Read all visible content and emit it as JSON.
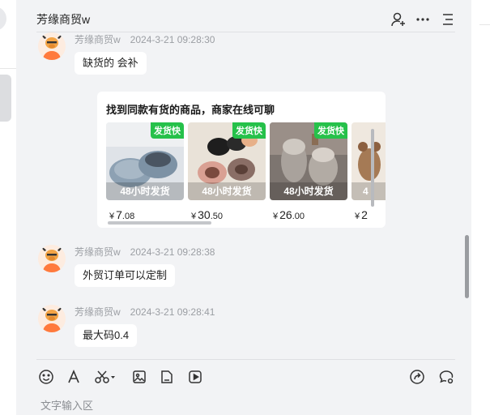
{
  "chat": {
    "title": "芳缘商贸w",
    "messages": [
      {
        "sender": "芳缘商贸w",
        "time": "2024-3-21 09:28:30",
        "text": "缺货的    会补"
      },
      {
        "sender": "芳缘商贸w",
        "time": "2024-3-21 09:28:38",
        "text": "外贸订单可以定制"
      },
      {
        "sender": "芳缘商贸w",
        "time": "2024-3-21 09:28:41",
        "text": "最大码0.4"
      }
    ],
    "product_card": {
      "title": "找到同款有货的商品，商家在线可聊",
      "products": [
        {
          "badge": "发货快",
          "caption": "48小时发货",
          "currency": "¥",
          "price_int": "7",
          "price_dec": ".08"
        },
        {
          "badge": "发货快",
          "caption": "48小时发货",
          "currency": "¥",
          "price_int": "30",
          "price_dec": ".50"
        },
        {
          "badge": "发货快",
          "caption": "48小时发货",
          "currency": "¥",
          "price_int": "26",
          "price_dec": ".00"
        },
        {
          "badge": "",
          "caption": "4",
          "currency": "¥",
          "price_int": "2",
          "price_dec": ""
        }
      ]
    }
  },
  "composer": {
    "placeholder": "文字输入区"
  },
  "icons": {
    "header": [
      "add-contact-icon",
      "more-icon",
      "menu-icon"
    ],
    "toolbar_left": [
      "emoji-icon",
      "font-icon",
      "scissors-icon",
      "image-icon",
      "file-icon",
      "video-icon"
    ],
    "toolbar_right": [
      "share-icon",
      "chat-settings-icon"
    ]
  },
  "colors": {
    "badge": "#26c14a",
    "background": "#f2f3f5"
  }
}
